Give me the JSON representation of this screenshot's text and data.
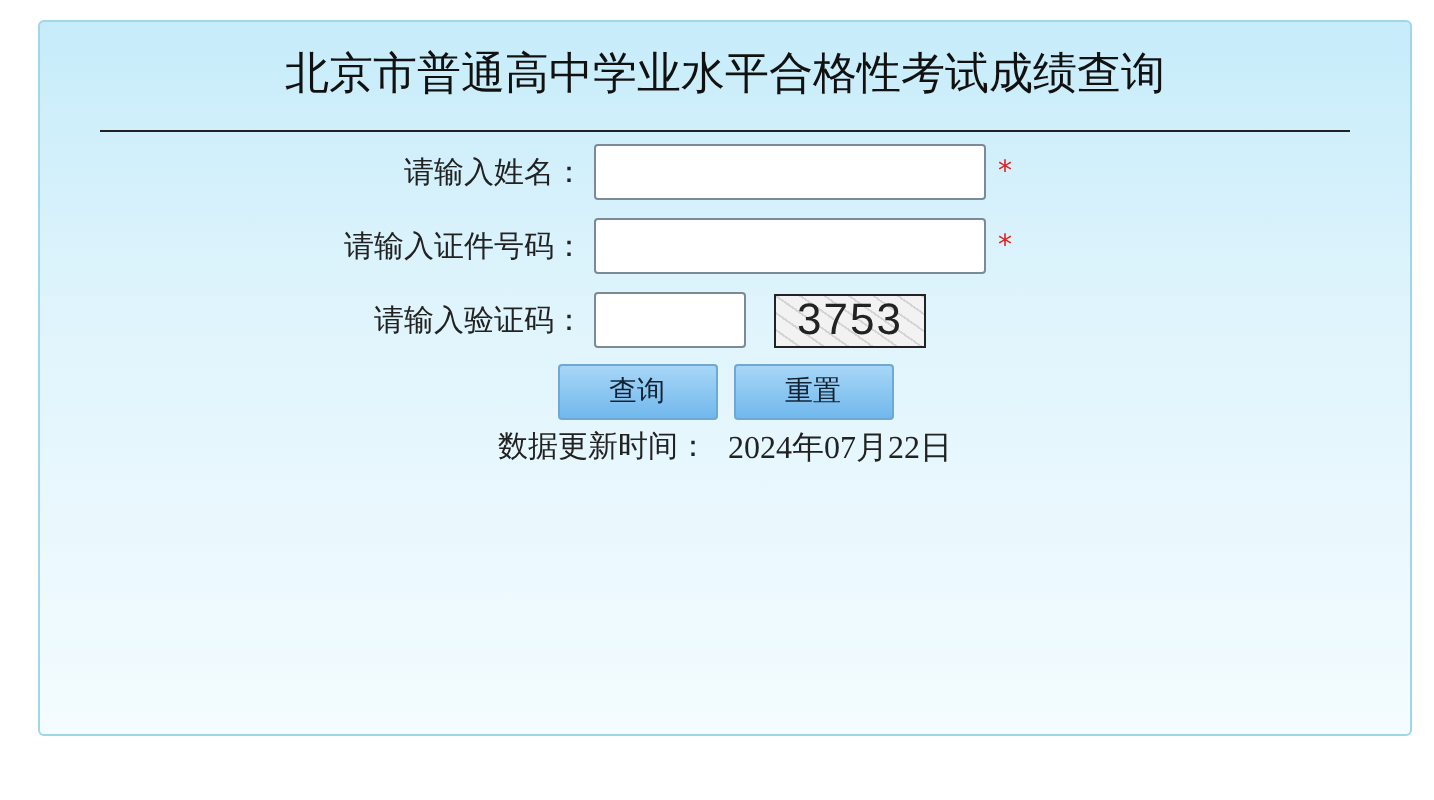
{
  "title": "北京市普通高中学业水平合格性考试成绩查询",
  "fields": [
    {
      "kind": "text",
      "label": "请输入姓名：",
      "required_mark": "*"
    },
    {
      "kind": "text",
      "label": "请输入证件号码：",
      "required_mark": "*"
    },
    {
      "kind": "captcha",
      "label": "请输入验证码：",
      "captcha": "3753"
    }
  ],
  "buttons": [
    "查询",
    "重置"
  ],
  "update": {
    "label": "数据更新时间：",
    "date": "2024年07月22日"
  }
}
